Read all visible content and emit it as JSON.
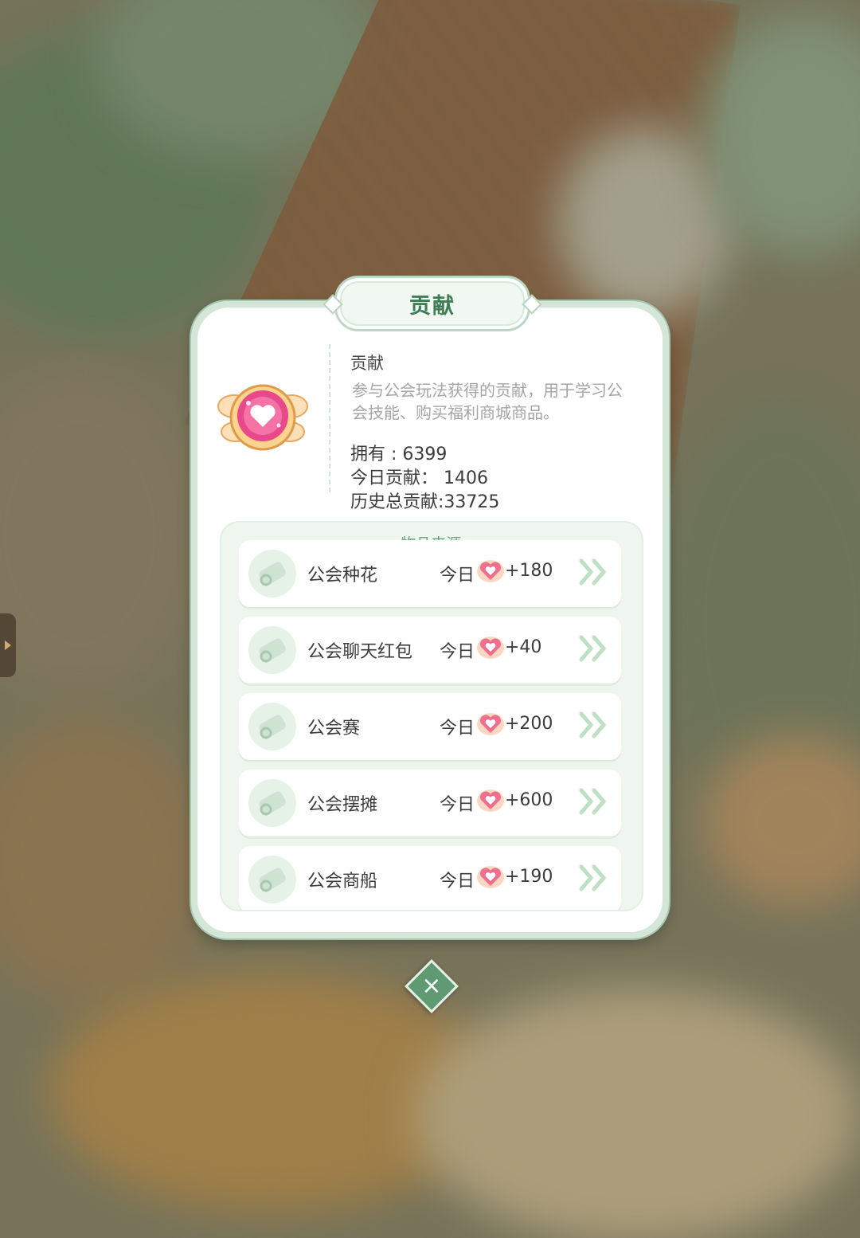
{
  "dialog": {
    "title": "贡献",
    "item_name": "贡献",
    "item_desc": "参与公会玩法获得的贡献，用于学习公会技能、购买福利商城商品。",
    "owned": "拥有 : 6399",
    "today": "今日贡献： 1406",
    "history": "历史总贡献:33725",
    "item_icon": "heart-medal-icon"
  },
  "sources": {
    "header": "物品来源",
    "today_label": "今日",
    "rows": [
      {
        "name": "公会种花",
        "value": "+180",
        "icon": "scroll-icon"
      },
      {
        "name": "公会聊天红包",
        "value": "+40",
        "icon": "scroll-icon"
      },
      {
        "name": "公会赛",
        "value": "+200",
        "icon": "scroll-icon"
      },
      {
        "name": "公会摆摊",
        "value": "+600",
        "icon": "scroll-icon"
      },
      {
        "name": "公会商船",
        "value": "+190",
        "icon": "scroll-icon"
      }
    ]
  },
  "close": {
    "icon": "close-icon",
    "glyph": "×"
  },
  "colors": {
    "accent_green": "#3f7d57",
    "panel_border": "#a6c6ad",
    "list_bg": "#eef6ef",
    "heart_pink": "#f06f8e"
  }
}
